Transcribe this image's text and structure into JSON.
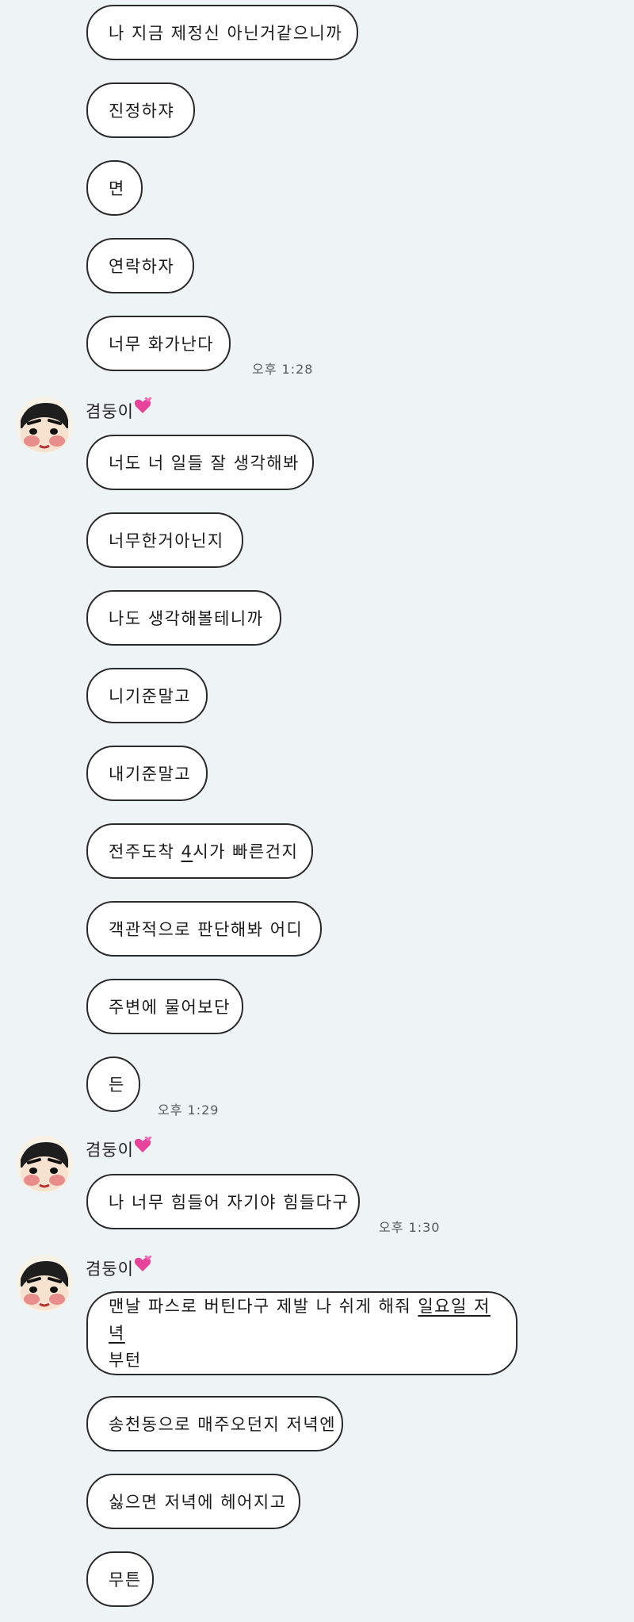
{
  "colors": {
    "background": "#eef3f6",
    "bubble_fill": "#ffffff",
    "bubble_border": "#2a2a2a",
    "heart": "#e8439a"
  },
  "messages": {
    "m1": "나 지금 제정신 아닌거같으니까",
    "m2": "진정하쟈",
    "m3": "면",
    "m4": "연락하자",
    "m5": "너무 화가난다",
    "t1": "오후 1:28",
    "sender1": "겸둥이",
    "m6": "너도 너 일들 잘 생각해봐",
    "m7": "너무한거아닌지",
    "m8": "나도 생각해볼테니까",
    "m9": "니기준말고",
    "m10": "내기준말고",
    "m11_a": "전주도착 ",
    "m11_b": "4",
    "m11_c": "시가 빠른건지",
    "m12": "객관적으로 판단해봐 어디",
    "m13": "주변에 물어보단",
    "m14": "든",
    "t2": "오후 1:29",
    "sender2": "겸둥이",
    "m15": "나 너무 힘들어 자기야 힘들다구",
    "t3": "오후 1:30",
    "sender3": "겸둥이",
    "m16_a": "맨날 파스로 버틴다구 제발 나 쉬게 해줘 ",
    "m16_b": "일요일 저녁",
    "m16_c": "부턴",
    "m17": "송천동으로 매주오던지 저녁엔",
    "m18": "싫으면 저녁에 헤어지고",
    "m19": "무튼"
  },
  "icons": {
    "heart": "pink-hearts-emoji",
    "avatar": "cartoon-boy-avatar"
  }
}
